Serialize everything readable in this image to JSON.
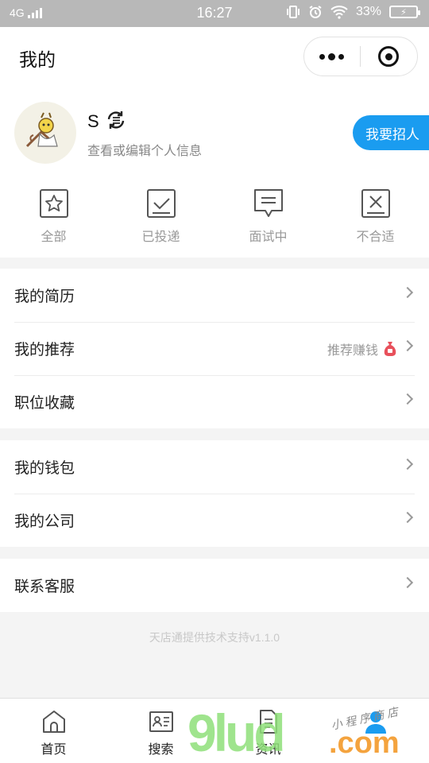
{
  "status_bar": {
    "network": "4G",
    "time": "16:27",
    "battery": "33%"
  },
  "nav": {
    "title": "我的"
  },
  "profile": {
    "name": "S",
    "subtitle": "查看或编辑个人信息",
    "recruit_button": "我要招人"
  },
  "stats": [
    {
      "label": "全部",
      "icon": "star-box-icon"
    },
    {
      "label": "已投递",
      "icon": "check-box-icon"
    },
    {
      "label": "面试中",
      "icon": "chat-box-icon"
    },
    {
      "label": "不合适",
      "icon": "x-box-icon"
    }
  ],
  "menu": {
    "resume": "我的简历",
    "recommend": "我的推荐",
    "recommend_extra": "推荐赚钱",
    "favorites": "职位收藏",
    "wallet": "我的钱包",
    "company": "我的公司",
    "support": "联系客服"
  },
  "footer_note": "天店通提供技术支持v1.1.0",
  "tabbar": [
    {
      "label": "首页",
      "icon": "home-icon"
    },
    {
      "label": "搜索",
      "icon": "search-card-icon"
    },
    {
      "label": "资讯",
      "icon": "document-icon"
    },
    {
      "label": "",
      "icon": "person-icon",
      "active": true
    }
  ],
  "watermark": {
    "number": "9l",
    "domain": ".com",
    "letters": "ud",
    "handwriting": "小 程 序 商 店"
  },
  "colors": {
    "accent": "#1a9cf0",
    "status_bar": "#b8b8b8"
  }
}
